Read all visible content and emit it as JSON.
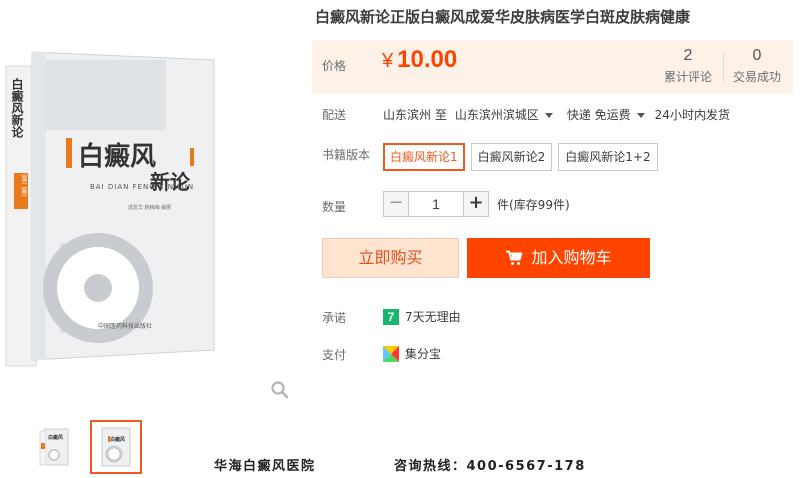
{
  "product": {
    "title": "白癜风新论正版白癜风成爱华皮肤病医学白斑皮肤病健康"
  },
  "price": {
    "label": "价格",
    "currency": "¥",
    "amount": "10.00",
    "color": "#ff4400"
  },
  "stats": {
    "reviews_count": "2",
    "reviews_label": "累计评论",
    "sales_count": "0",
    "sales_label": "交易成功"
  },
  "delivery": {
    "label": "配送",
    "from": "山东滨州 至",
    "to": "山东滨州滨城区",
    "shipping": "快递 免运费",
    "dispatch": "24小时内发货"
  },
  "edition": {
    "label": "书籍版本",
    "options": [
      "白癜风新论1",
      "白癜风新论2",
      "白癜风新论1+2"
    ],
    "selected": "白癜风新论1"
  },
  "quantity": {
    "label": "数量",
    "value": "1",
    "minus": "−",
    "plus": "+",
    "stock_text": "件(库存99件)"
  },
  "actions": {
    "buy_now": "立即购买",
    "add_to_cart": "加入购物车"
  },
  "promise": {
    "label": "承诺",
    "badge": "7",
    "text": "7天无理由"
  },
  "payment": {
    "label": "支付",
    "text": "集分宝"
  },
  "book_cover": {
    "title_main": "白癜风",
    "title_sub": "新论",
    "pinyin": "BAI DIAN FENG XIN LUN",
    "authors": "成爱华 韩梅梅 编著",
    "publisher": "中国医药科技出版社",
    "spine_title": "白癜风新论",
    "spine_edition": "(第二版)"
  },
  "footer": {
    "hospital": "华海白癜风医院",
    "hotline": "咨询热线：400-6567-178"
  },
  "icons": {
    "zoom": "zoom-icon",
    "cart": "cart-icon",
    "caret": "chevron-down-icon",
    "payment": "jifenbao-icon"
  }
}
